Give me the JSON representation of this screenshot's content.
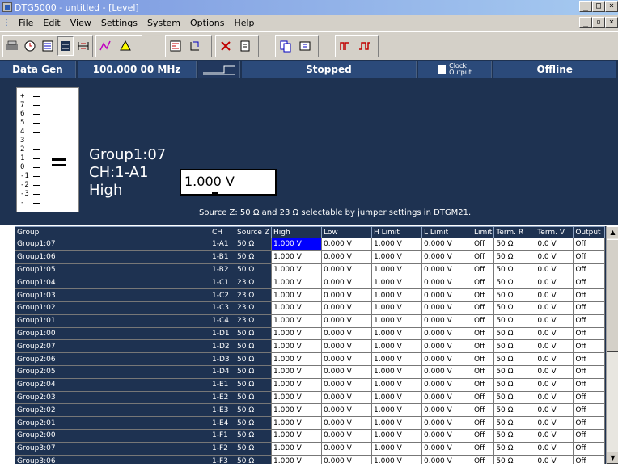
{
  "window": {
    "title": "DTG5000 - untitled - [Level]",
    "controls": [
      "_",
      "□",
      "×"
    ],
    "mdi_controls": [
      "_",
      "▫",
      "×"
    ]
  },
  "menu": {
    "file": "File",
    "edit": "Edit",
    "view": "View",
    "settings": "Settings",
    "system": "System",
    "options": "Options",
    "help": "Help"
  },
  "toolbar": {
    "icons": [
      "setup-icon",
      "timing-icon",
      "listing-icon",
      "level-icon",
      "data-gen-icon",
      "pattern-icon",
      "waveform-icon",
      "sequence-icon",
      "jump-icon",
      "delay-icon",
      "output-icon",
      "copy-icon",
      "run-icon",
      "step-icon"
    ]
  },
  "status": {
    "mode": "Data Gen",
    "frequency": "100.000 00 MHz",
    "run_state": "Stopped",
    "clock_output_line1": "Clock",
    "clock_output_line2": "Output",
    "connection": "Offline"
  },
  "level": {
    "scale": [
      "+",
      "7",
      "6",
      "5",
      "4",
      "3",
      "2",
      "1",
      "0",
      "-1",
      "-2",
      "-3",
      "-"
    ],
    "group": "Group1:07",
    "channel": "CH:1-A1",
    "type": "High",
    "value": "1.000 V",
    "source_note": "Source Z:  50 Ω  and  23 Ω  selectable by jumper settings in DTGM21."
  },
  "grid": {
    "columns": [
      "Group",
      "CH",
      "Source Z",
      "High",
      "Low",
      "H Limit",
      "L Limit",
      "Limit",
      "Term. R",
      "Term. V",
      "Output"
    ],
    "rows": [
      [
        "Group1:07",
        "1-A1",
        "50 Ω",
        "1.000 V",
        "0.000 V",
        "1.000 V",
        "0.000 V",
        "Off",
        "50 Ω",
        "0.0 V",
        "Off"
      ],
      [
        "Group1:06",
        "1-B1",
        "50 Ω",
        "1.000 V",
        "0.000 V",
        "1.000 V",
        "0.000 V",
        "Off",
        "50 Ω",
        "0.0 V",
        "Off"
      ],
      [
        "Group1:05",
        "1-B2",
        "50 Ω",
        "1.000 V",
        "0.000 V",
        "1.000 V",
        "0.000 V",
        "Off",
        "50 Ω",
        "0.0 V",
        "Off"
      ],
      [
        "Group1:04",
        "1-C1",
        "23 Ω",
        "1.000 V",
        "0.000 V",
        "1.000 V",
        "0.000 V",
        "Off",
        "50 Ω",
        "0.0 V",
        "Off"
      ],
      [
        "Group1:03",
        "1-C2",
        "23 Ω",
        "1.000 V",
        "0.000 V",
        "1.000 V",
        "0.000 V",
        "Off",
        "50 Ω",
        "0.0 V",
        "Off"
      ],
      [
        "Group1:02",
        "1-C3",
        "23 Ω",
        "1.000 V",
        "0.000 V",
        "1.000 V",
        "0.000 V",
        "Off",
        "50 Ω",
        "0.0 V",
        "Off"
      ],
      [
        "Group1:01",
        "1-C4",
        "23 Ω",
        "1.000 V",
        "0.000 V",
        "1.000 V",
        "0.000 V",
        "Off",
        "50 Ω",
        "0.0 V",
        "Off"
      ],
      [
        "Group1:00",
        "1-D1",
        "50 Ω",
        "1.000 V",
        "0.000 V",
        "1.000 V",
        "0.000 V",
        "Off",
        "50 Ω",
        "0.0 V",
        "Off"
      ],
      [
        "Group2:07",
        "1-D2",
        "50 Ω",
        "1.000 V",
        "0.000 V",
        "1.000 V",
        "0.000 V",
        "Off",
        "50 Ω",
        "0.0 V",
        "Off"
      ],
      [
        "Group2:06",
        "1-D3",
        "50 Ω",
        "1.000 V",
        "0.000 V",
        "1.000 V",
        "0.000 V",
        "Off",
        "50 Ω",
        "0.0 V",
        "Off"
      ],
      [
        "Group2:05",
        "1-D4",
        "50 Ω",
        "1.000 V",
        "0.000 V",
        "1.000 V",
        "0.000 V",
        "Off",
        "50 Ω",
        "0.0 V",
        "Off"
      ],
      [
        "Group2:04",
        "1-E1",
        "50 Ω",
        "1.000 V",
        "0.000 V",
        "1.000 V",
        "0.000 V",
        "Off",
        "50 Ω",
        "0.0 V",
        "Off"
      ],
      [
        "Group2:03",
        "1-E2",
        "50 Ω",
        "1.000 V",
        "0.000 V",
        "1.000 V",
        "0.000 V",
        "Off",
        "50 Ω",
        "0.0 V",
        "Off"
      ],
      [
        "Group2:02",
        "1-E3",
        "50 Ω",
        "1.000 V",
        "0.000 V",
        "1.000 V",
        "0.000 V",
        "Off",
        "50 Ω",
        "0.0 V",
        "Off"
      ],
      [
        "Group2:01",
        "1-E4",
        "50 Ω",
        "1.000 V",
        "0.000 V",
        "1.000 V",
        "0.000 V",
        "Off",
        "50 Ω",
        "0.0 V",
        "Off"
      ],
      [
        "Group2:00",
        "1-F1",
        "50 Ω",
        "1.000 V",
        "0.000 V",
        "1.000 V",
        "0.000 V",
        "Off",
        "50 Ω",
        "0.0 V",
        "Off"
      ],
      [
        "Group3:07",
        "1-F2",
        "50 Ω",
        "1.000 V",
        "0.000 V",
        "1.000 V",
        "0.000 V",
        "Off",
        "50 Ω",
        "0.0 V",
        "Off"
      ],
      [
        "Group3:06",
        "1-F3",
        "50 Ω",
        "1.000 V",
        "0.000 V",
        "1.000 V",
        "0.000 V",
        "Off",
        "50 Ω",
        "0.0 V",
        "Off"
      ]
    ],
    "selected_row": 0,
    "selected_col": 3
  },
  "colors": {
    "panel_bg": "#1e3251",
    "selection": "#0000ff",
    "title_gradient_start": "#7a96df"
  }
}
